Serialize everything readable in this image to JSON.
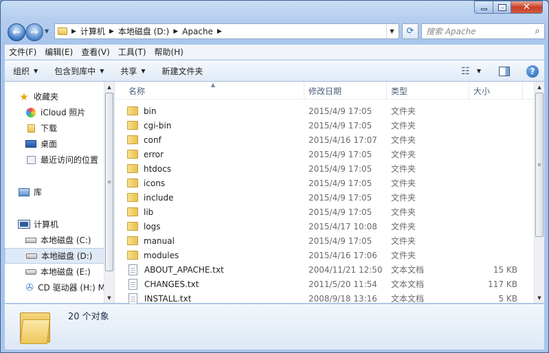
{
  "window": {
    "caption_buttons": {
      "min": "",
      "max": "",
      "close": "✕"
    }
  },
  "address": {
    "crumbs": [
      "计算机",
      "本地磁盘 (D:)",
      "Apache"
    ]
  },
  "search": {
    "placeholder": "搜索 Apache"
  },
  "menu": [
    "文件(F)",
    "编辑(E)",
    "查看(V)",
    "工具(T)",
    "帮助(H)"
  ],
  "toolbar": {
    "organize": "组织",
    "include_in_library": "包含到库中",
    "share": "共享",
    "new_folder": "新建文件夹"
  },
  "nav": {
    "favorites": "收藏夹",
    "icloud_photos": "iCloud 照片",
    "downloads": "下载",
    "desktop": "桌面",
    "recent": "最近访问的位置",
    "libraries": "库",
    "computer": "计算机",
    "drive_c": "本地磁盘 (C:)",
    "drive_d": "本地磁盘 (D:)",
    "drive_e": "本地磁盘 (E:)",
    "cd_drive": "CD 驱动器 (H:) M"
  },
  "columns": {
    "name": "名称",
    "date": "修改日期",
    "type": "类型",
    "size": "大小"
  },
  "files": [
    {
      "name": "bin",
      "date": "2015/4/9 17:05",
      "type": "文件夹",
      "size": "",
      "kind": "folder"
    },
    {
      "name": "cgi-bin",
      "date": "2015/4/9 17:05",
      "type": "文件夹",
      "size": "",
      "kind": "folder"
    },
    {
      "name": "conf",
      "date": "2015/4/16 17:07",
      "type": "文件夹",
      "size": "",
      "kind": "folder"
    },
    {
      "name": "error",
      "date": "2015/4/9 17:05",
      "type": "文件夹",
      "size": "",
      "kind": "folder"
    },
    {
      "name": "htdocs",
      "date": "2015/4/9 17:05",
      "type": "文件夹",
      "size": "",
      "kind": "folder"
    },
    {
      "name": "icons",
      "date": "2015/4/9 17:05",
      "type": "文件夹",
      "size": "",
      "kind": "folder"
    },
    {
      "name": "include",
      "date": "2015/4/9 17:05",
      "type": "文件夹",
      "size": "",
      "kind": "folder"
    },
    {
      "name": "lib",
      "date": "2015/4/9 17:05",
      "type": "文件夹",
      "size": "",
      "kind": "folder"
    },
    {
      "name": "logs",
      "date": "2015/4/17 10:08",
      "type": "文件夹",
      "size": "",
      "kind": "folder"
    },
    {
      "name": "manual",
      "date": "2015/4/9 17:05",
      "type": "文件夹",
      "size": "",
      "kind": "folder"
    },
    {
      "name": "modules",
      "date": "2015/4/16 17:06",
      "type": "文件夹",
      "size": "",
      "kind": "folder"
    },
    {
      "name": "ABOUT_APACHE.txt",
      "date": "2004/11/21 12:50",
      "type": "文本文档",
      "size": "15 KB",
      "kind": "txt"
    },
    {
      "name": "CHANGES.txt",
      "date": "2011/5/20 11:54",
      "type": "文本文档",
      "size": "117 KB",
      "kind": "txt"
    },
    {
      "name": "INSTALL.txt",
      "date": "2008/9/18 13:16",
      "type": "文本文档",
      "size": "5 KB",
      "kind": "txt"
    }
  ],
  "status": {
    "count": "20 个对象"
  }
}
